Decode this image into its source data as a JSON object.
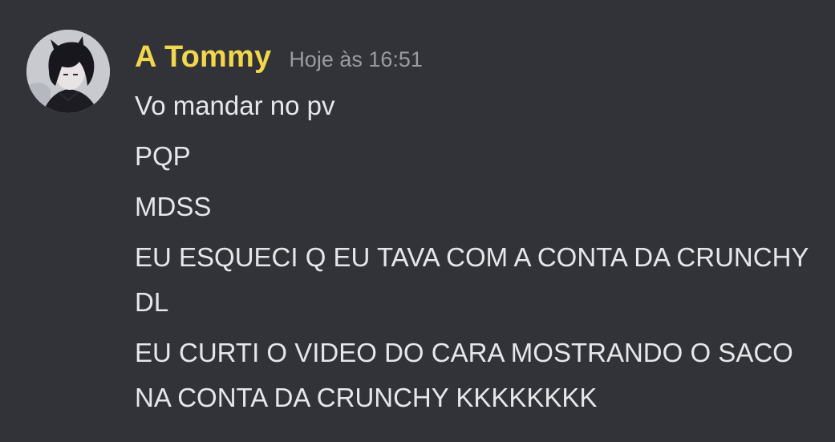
{
  "author": {
    "name": "A Tommy",
    "name_color": "#f2d64c",
    "avatar_icon": "anime-character-avatar"
  },
  "timestamp": "Hoje às 16:51",
  "messages": [
    {
      "text": "Vo mandar no pv"
    },
    {
      "text": "PQP"
    },
    {
      "text": "MDSS"
    },
    {
      "text": "EU ESQUECI Q EU TAVA COM A CONTA DA CRUNCHY DL"
    },
    {
      "text": "EU CURTI O VIDEO DO CARA MOSTRANDO O SACO NA CONTA DA CRUNCHY KKKKKKKK"
    }
  ],
  "colors": {
    "background": "#313338",
    "message_text": "#e6e7ea",
    "timestamp_text": "#9a9ba3"
  }
}
